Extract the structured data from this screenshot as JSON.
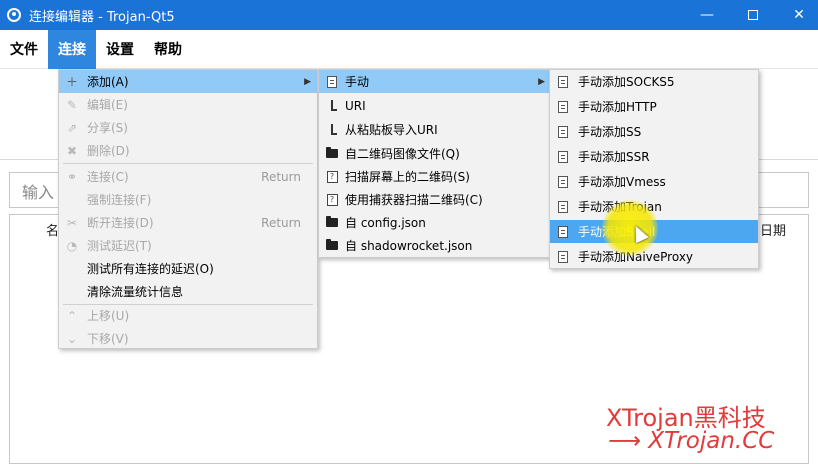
{
  "window": {
    "title": "连接编辑器 - Trojan-Qt5",
    "min": "—",
    "close": "✕"
  },
  "menubar": [
    "文件",
    "连接",
    "设置",
    "帮助"
  ],
  "search_placeholder": "输入",
  "columns": {
    "name": "名",
    "date": "日期"
  },
  "connection_menu": [
    {
      "label": "添加(A)",
      "icon": "plus-icon",
      "disabled": false
    },
    {
      "label": "编辑(E)",
      "icon": "edit-icon",
      "disabled": true
    },
    {
      "label": "分享(S)",
      "icon": "share-icon",
      "disabled": true
    },
    {
      "label": "删除(D)",
      "icon": "delete-icon",
      "disabled": true
    },
    {
      "label": "连接(C)",
      "icon": "link-icon",
      "disabled": true,
      "shortcut": "Return"
    },
    {
      "label": "强制连接(F)",
      "icon": "",
      "disabled": true
    },
    {
      "label": "断开连接(D)",
      "icon": "unlink-icon",
      "disabled": true,
      "shortcut": "Return"
    },
    {
      "label": "测试延迟(T)",
      "icon": "speed-icon",
      "disabled": true
    },
    {
      "label": "测试所有连接的延迟(O)",
      "icon": "",
      "disabled": false
    },
    {
      "label": "清除流量统计信息",
      "icon": "",
      "disabled": false
    },
    {
      "label": "上移(U)",
      "icon": "chevron-up-icon",
      "disabled": true
    },
    {
      "label": "下移(V)",
      "icon": "chevron-down-icon",
      "disabled": true
    }
  ],
  "add_menu": [
    {
      "label": "手动",
      "icon": "doc-icon"
    },
    {
      "label": "URI",
      "icon": "cursor-icon"
    },
    {
      "label": "从粘贴板导入URI",
      "icon": "cursor-icon"
    },
    {
      "label": "自二维码图像文件(Q)",
      "icon": "folder-icon"
    },
    {
      "label": "扫描屏幕上的二维码(S)",
      "icon": "qr-icon"
    },
    {
      "label": "使用捕获器扫描二维码(C)",
      "icon": "qr-icon"
    },
    {
      "label": "自 config.json",
      "icon": "folder-icon"
    },
    {
      "label": "自 shadowrocket.json",
      "icon": "folder-icon"
    }
  ],
  "manual_menu": [
    "手动添加SOCKS5",
    "手动添加HTTP",
    "手动添加SS",
    "手动添加SSR",
    "手动添加Vmess",
    "手动添加Trojan",
    "手动添加Snell",
    "手动添加NaiveProxy"
  ],
  "watermark": {
    "line1": "XTrojan黑科技",
    "arrow": "⟶",
    "line2": "XTrojan.CC"
  }
}
